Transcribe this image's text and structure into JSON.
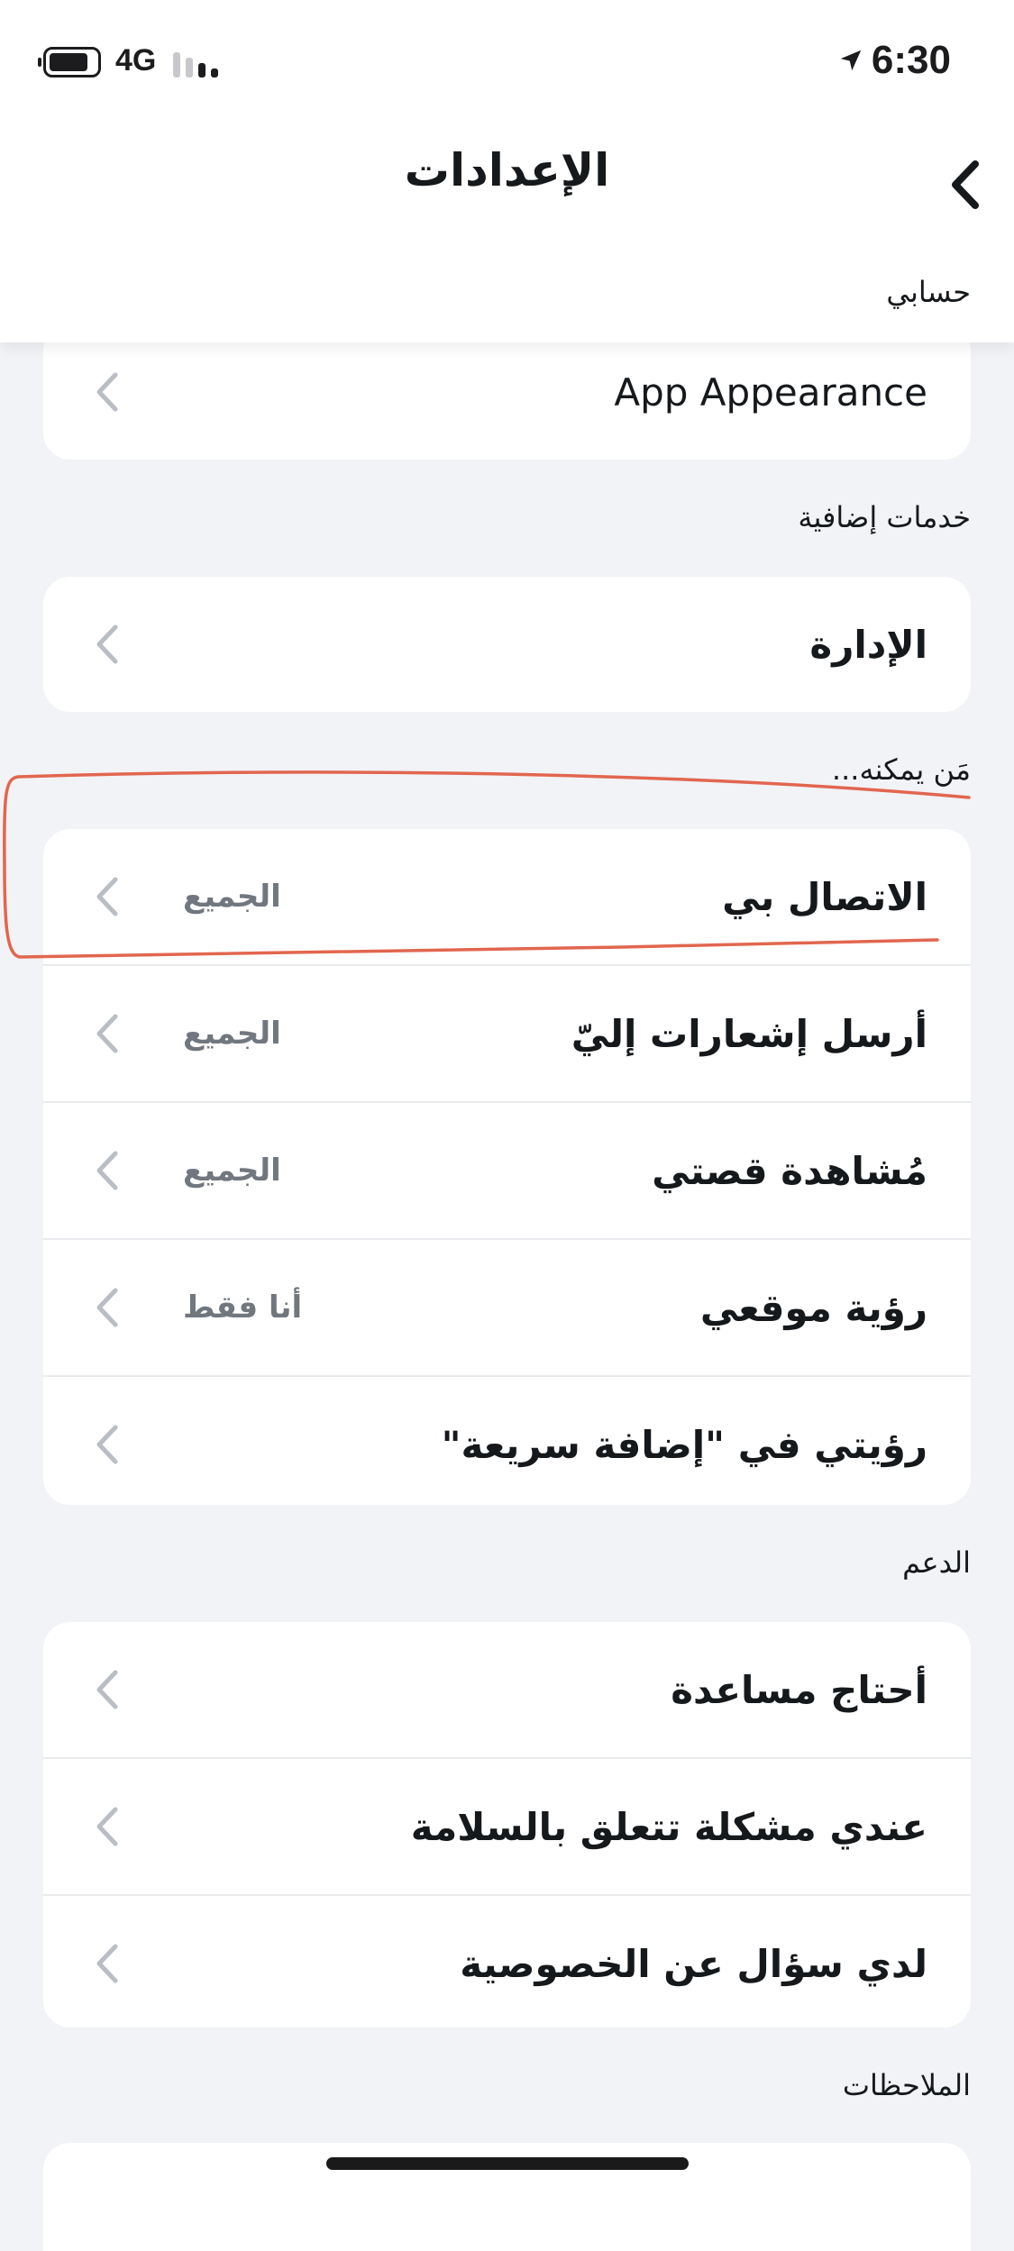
{
  "status_bar": {
    "network": "4G",
    "time": "6:30"
  },
  "header": {
    "title": "الإعدادات",
    "section": "حسابي"
  },
  "account": {
    "items": [
      {
        "label": "App Appearance"
      }
    ]
  },
  "extra_services": {
    "label": "خدمات إضافية",
    "items": [
      {
        "label": "الإدارة"
      }
    ]
  },
  "who_can": {
    "label": "مَن يمكنه...",
    "items": [
      {
        "label": "الاتصال بي",
        "value": "الجميع"
      },
      {
        "label": "أرسل إشعارات إليّ",
        "value": "الجميع"
      },
      {
        "label": "مُشاهدة قصتي",
        "value": "الجميع"
      },
      {
        "label": "رؤية موقعي",
        "value": "أنا فقط"
      },
      {
        "label": "رؤيتي في \"إضافة سريعة\""
      }
    ]
  },
  "support": {
    "label": "الدعم",
    "items": [
      {
        "label": "أحتاج مساعدة"
      },
      {
        "label": "عندي مشكلة تتعلق بالسلامة"
      },
      {
        "label": "لدي سؤال عن الخصوصية"
      }
    ]
  },
  "notes": {
    "label": "الملاحظات"
  },
  "colors": {
    "background": "#f2f3f6",
    "card": "#ffffff",
    "text": "#16191c",
    "secondary_text": "#70777e",
    "chevron": "#b9bec4",
    "annotation": "#e2664f"
  }
}
